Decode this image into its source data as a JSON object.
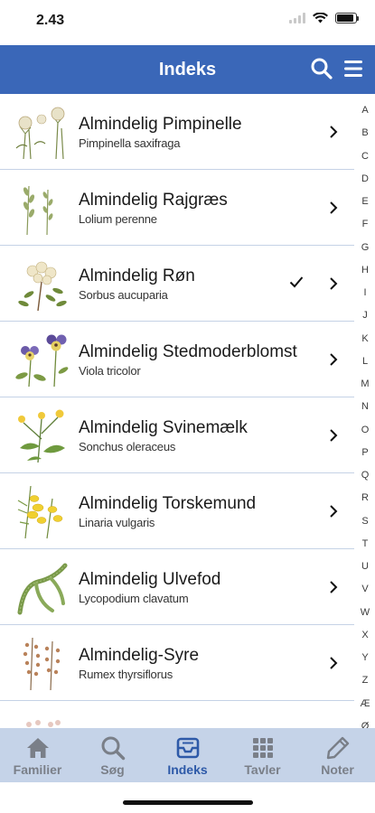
{
  "status": {
    "time": "2.43"
  },
  "nav": {
    "title": "Indeks"
  },
  "rows": [
    {
      "name": "Almindelig Pimpinelle",
      "latin": "Pimpinella saxifraga",
      "checked": false,
      "icon": "pimpinelle-plant-illustration"
    },
    {
      "name": "Almindelig Rajgræs",
      "latin": "Lolium perenne",
      "checked": false,
      "icon": "grass-plant-illustration"
    },
    {
      "name": "Almindelig Røn",
      "latin": "Sorbus aucuparia",
      "checked": true,
      "icon": "rowan-plant-illustration"
    },
    {
      "name": "Almindelig Stedmoderblomst",
      "latin": "Viola tricolor",
      "checked": false,
      "icon": "pansy-plant-illustration"
    },
    {
      "name": "Almindelig Svinemælk",
      "latin": "Sonchus oleraceus",
      "checked": false,
      "icon": "sowthistle-plant-illustration"
    },
    {
      "name": "Almindelig Torskemund",
      "latin": "Linaria vulgaris",
      "checked": false,
      "icon": "toadflax-plant-illustration"
    },
    {
      "name": "Almindelig Ulvefod",
      "latin": "Lycopodium clavatum",
      "checked": false,
      "icon": "clubmoss-plant-illustration"
    },
    {
      "name": "Almindelig-Syre",
      "latin": "Rumex thyrsiflorus",
      "checked": false,
      "icon": "sorrel-plant-illustration"
    }
  ],
  "alphabet": [
    "A",
    "B",
    "C",
    "D",
    "E",
    "F",
    "G",
    "H",
    "I",
    "J",
    "K",
    "L",
    "M",
    "N",
    "O",
    "P",
    "Q",
    "R",
    "S",
    "T",
    "U",
    "V",
    "W",
    "X",
    "Y",
    "Z",
    "Æ",
    "Ø"
  ],
  "tabs": [
    {
      "label": "Familier",
      "icon": "home-icon",
      "active": false
    },
    {
      "label": "Søg",
      "icon": "search-icon",
      "active": false
    },
    {
      "label": "Indeks",
      "icon": "inbox-icon",
      "active": true
    },
    {
      "label": "Tavler",
      "icon": "grid-icon",
      "active": false
    },
    {
      "label": "Noter",
      "icon": "pencil-icon",
      "active": false
    }
  ],
  "colors": {
    "accent": "#3a67b8",
    "tab_bar": "#c5d3e8",
    "tab_active": "#2e5aa8",
    "tab_inactive": "#7a7f88"
  }
}
